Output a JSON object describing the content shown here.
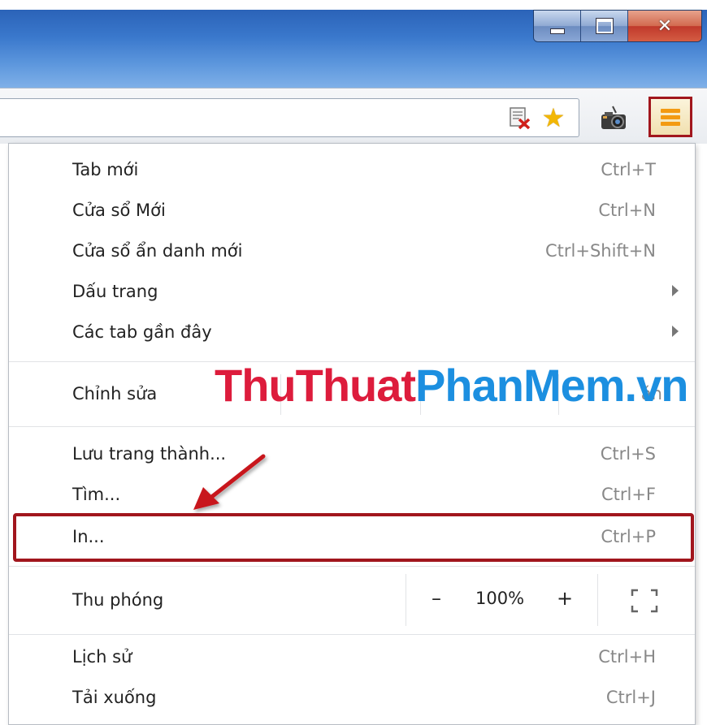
{
  "menu": {
    "new_tab": {
      "label": "Tab mới",
      "shortcut": "Ctrl+T"
    },
    "new_window": {
      "label": "Cửa sổ Mới",
      "shortcut": "Ctrl+N"
    },
    "incognito": {
      "label": "Cửa sổ ẩn danh mới",
      "shortcut": "Ctrl+Shift+N"
    },
    "bookmarks": {
      "label": "Dấu trang"
    },
    "recent_tabs": {
      "label": "Các tab gần đây"
    },
    "edit": {
      "label": "Chỉnh sửa",
      "paste_partial": "án"
    },
    "save_page": {
      "label": "Lưu trang thành...",
      "shortcut": "Ctrl+S"
    },
    "find": {
      "label": "Tìm...",
      "shortcut": "Ctrl+F"
    },
    "print": {
      "label": "In...",
      "shortcut": "Ctrl+P"
    },
    "zoom": {
      "label": "Thu phóng",
      "minus": "–",
      "value": "100%",
      "plus": "+"
    },
    "history": {
      "label": "Lịch sử",
      "shortcut": "Ctrl+H"
    },
    "downloads": {
      "label": "Tải xuống",
      "shortcut": "Ctrl+J"
    }
  },
  "watermark": {
    "part1": "ThuThuat",
    "part2": "PhanMem",
    "part3": ".vn"
  },
  "colors": {
    "highlight": "#a1161d",
    "watermark_red": "#dd1c3c",
    "watermark_blue": "#1c8fe0",
    "menu_icon": "#f39a12"
  },
  "icons": {
    "close": "✕",
    "star": "★"
  }
}
